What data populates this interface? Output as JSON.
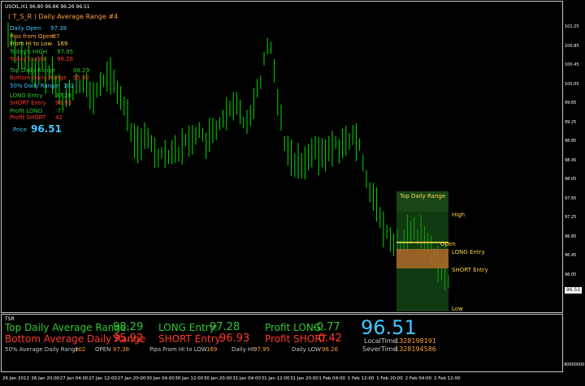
{
  "chart": {
    "symbol_header": "USOIL,H1  96.80 96.86 96.26 96.51",
    "indicator_title": "( T_S_R ) Daily Average Range #4",
    "price_labels": [
      "101.25",
      "100.85",
      "100.45",
      "100.05",
      "99.65",
      "99.25",
      "98.85",
      "98.45",
      "98.05",
      "97.65",
      "97.25",
      "96.85",
      "96.45",
      "96.05"
    ],
    "current_price_tag": "96.51",
    "bottom_value": "90000000",
    "time_labels": [
      "26 Jan 2012",
      "26 Jan 20:00",
      "27 Jan 04:00",
      "27 Jan 12:00",
      "27 Jan 20:00",
      "30 Jan 04:00",
      "30 Jan 12:00",
      "30 Jan 20:00",
      "31 Jan 04:00",
      "31 Jan 12:00",
      "31 Jan 20:00",
      "1 Feb 04:00",
      "1 Feb 12:00",
      "1 Feb 20:00",
      "2 Feb 04:00",
      "2 Feb 12:00"
    ],
    "stats": [
      {
        "label": "Daily Open",
        "value": "97.38",
        "color": "#3fc8ff"
      },
      {
        "label": "Pips from Open",
        "value": "-87",
        "color": "#ff9f3f"
      },
      {
        "label": "From Hi to Low",
        "value": "169",
        "color": "#ffd24a"
      },
      {
        "label": "Today's HIGH",
        "value": "97.95",
        "color": "#32c832"
      },
      {
        "label": "Today's LOW",
        "value": "96.26",
        "color": "#ff3a2a"
      },
      {
        "label": "Top Daily Range",
        "value": "98.29",
        "color": "#32c832"
      },
      {
        "label": "Bottom Daily Range",
        "value": "95.92",
        "color": "#ff3a2a"
      },
      {
        "label": "50% Daily Range",
        "value": "102",
        "color": "#3fc8ff"
      },
      {
        "label": "LONG Entry",
        "value": "97.28",
        "color": "#32c832"
      },
      {
        "label": "SHORT Entry",
        "value": "96.93",
        "color": "#ff3a2a"
      },
      {
        "label": "Profit LONG",
        "value": "-77",
        "color": "#32c832"
      },
      {
        "label": "Profit SHORT",
        "value": "42",
        "color": "#ff3a2a"
      }
    ],
    "price_label": "Price",
    "price_value": "96.51",
    "zone": {
      "title": "Top Daily Range",
      "high": "High",
      "open": "Open",
      "long_entry": "LONG Entry",
      "short_entry": "SHORT Entry",
      "low": "Low"
    }
  },
  "subwindow": {
    "name": "TSR",
    "top_range_label": "Top Daily Average Range:",
    "top_range_value": "98.29",
    "bottom_range_label": "Bottom Average Daily Range",
    "bottom_range_value": "95.92",
    "pct_label": "50% Average Daily Range",
    "pct_value": "102",
    "long_label": "LONG Entry:",
    "long_value": "97.28",
    "short_label": "SHORT Entry:",
    "short_value": "96.93",
    "open_label": "OPEN",
    "open_value": "97.38",
    "pips_label": "Pips From HI to LOW",
    "pips_value": "169",
    "high_label": "Daily HI:",
    "high_value": "97.95",
    "low_label": "Daily LOW",
    "low_value": "96.26",
    "profit_long_label": "Profit LONG:",
    "profit_long_value": "-0.77",
    "profit_short_label": "Profit SHORT",
    "profit_short_value": "0.42",
    "big_price": "96.51",
    "local_time_label": "LocalTime",
    "local_time_value": "1328198191",
    "server_time_label": "SeverTime",
    "server_time_value": "1328194586"
  },
  "colors": {
    "candle": "#00e000",
    "axis": "#ffffff",
    "zone_fill": "#1d6b1d",
    "zone_band": "#1a5a1a",
    "short_band": "#b06a2c",
    "cyan": "#3fc8ff",
    "red": "#ff3a2a",
    "green": "#32c832",
    "orange": "#ff9f3f"
  }
}
